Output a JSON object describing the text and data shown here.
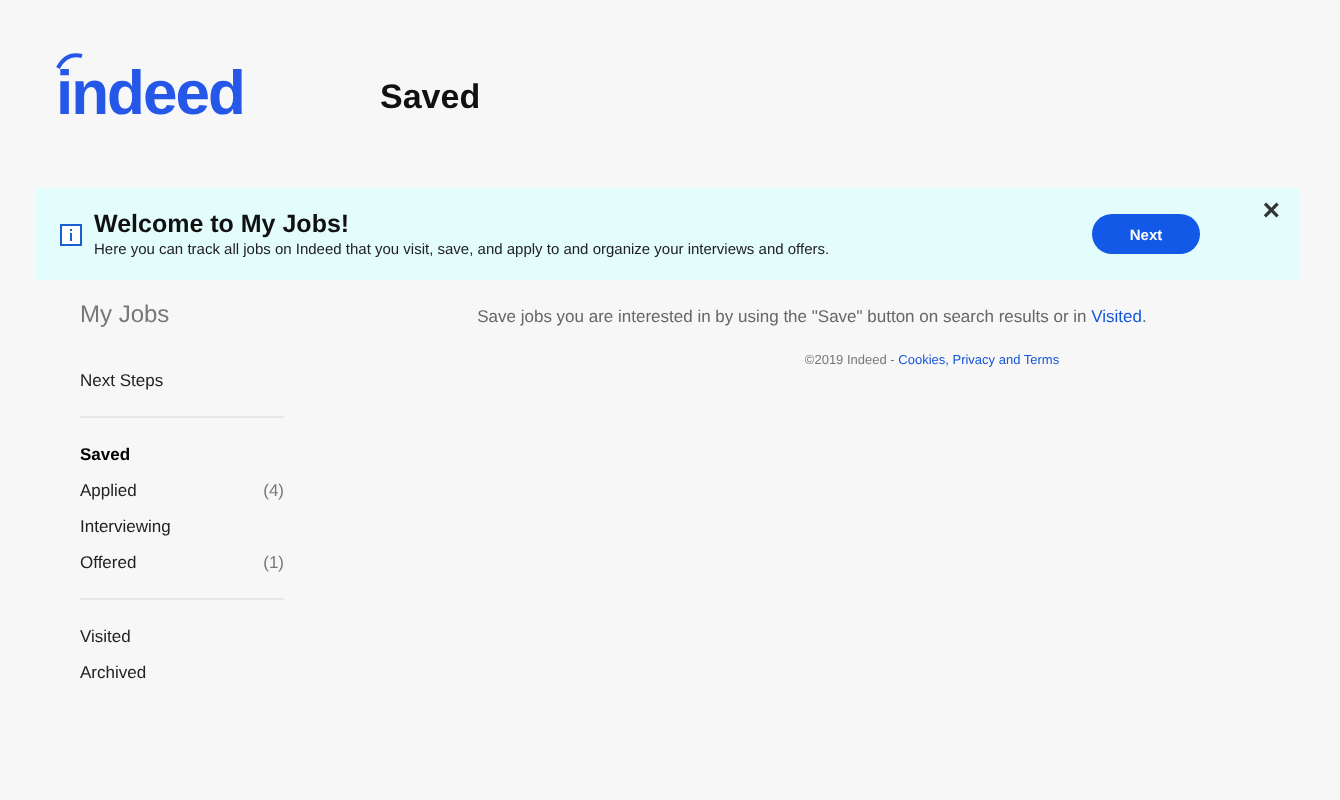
{
  "header": {
    "logo": "indeed",
    "title": "Saved"
  },
  "banner": {
    "title": "Welcome to My Jobs!",
    "text": "Here you can track all jobs on Indeed that you visit, save, and apply to and organize your interviews and offers.",
    "button": "Next",
    "close": "×"
  },
  "sidebar": {
    "title": "My Jobs",
    "groups": [
      [
        {
          "label": "Next Steps",
          "selected": false
        }
      ],
      [
        {
          "label": "Saved",
          "selected": true
        },
        {
          "label": "Applied",
          "count": "(4)",
          "selected": false
        },
        {
          "label": "Interviewing",
          "selected": false
        },
        {
          "label": "Offered",
          "count": "(1)",
          "selected": false
        }
      ],
      [
        {
          "label": "Visited",
          "selected": false
        },
        {
          "label": "Archived",
          "selected": false
        }
      ]
    ]
  },
  "main": {
    "message": "Save jobs you are interested in by using the \"Save\" button on search results or in",
    "message_link": "Visited",
    "message_end": ".",
    "footer": "©2019 Indeed -",
    "footer_link": "Cookies, Privacy and Terms"
  }
}
